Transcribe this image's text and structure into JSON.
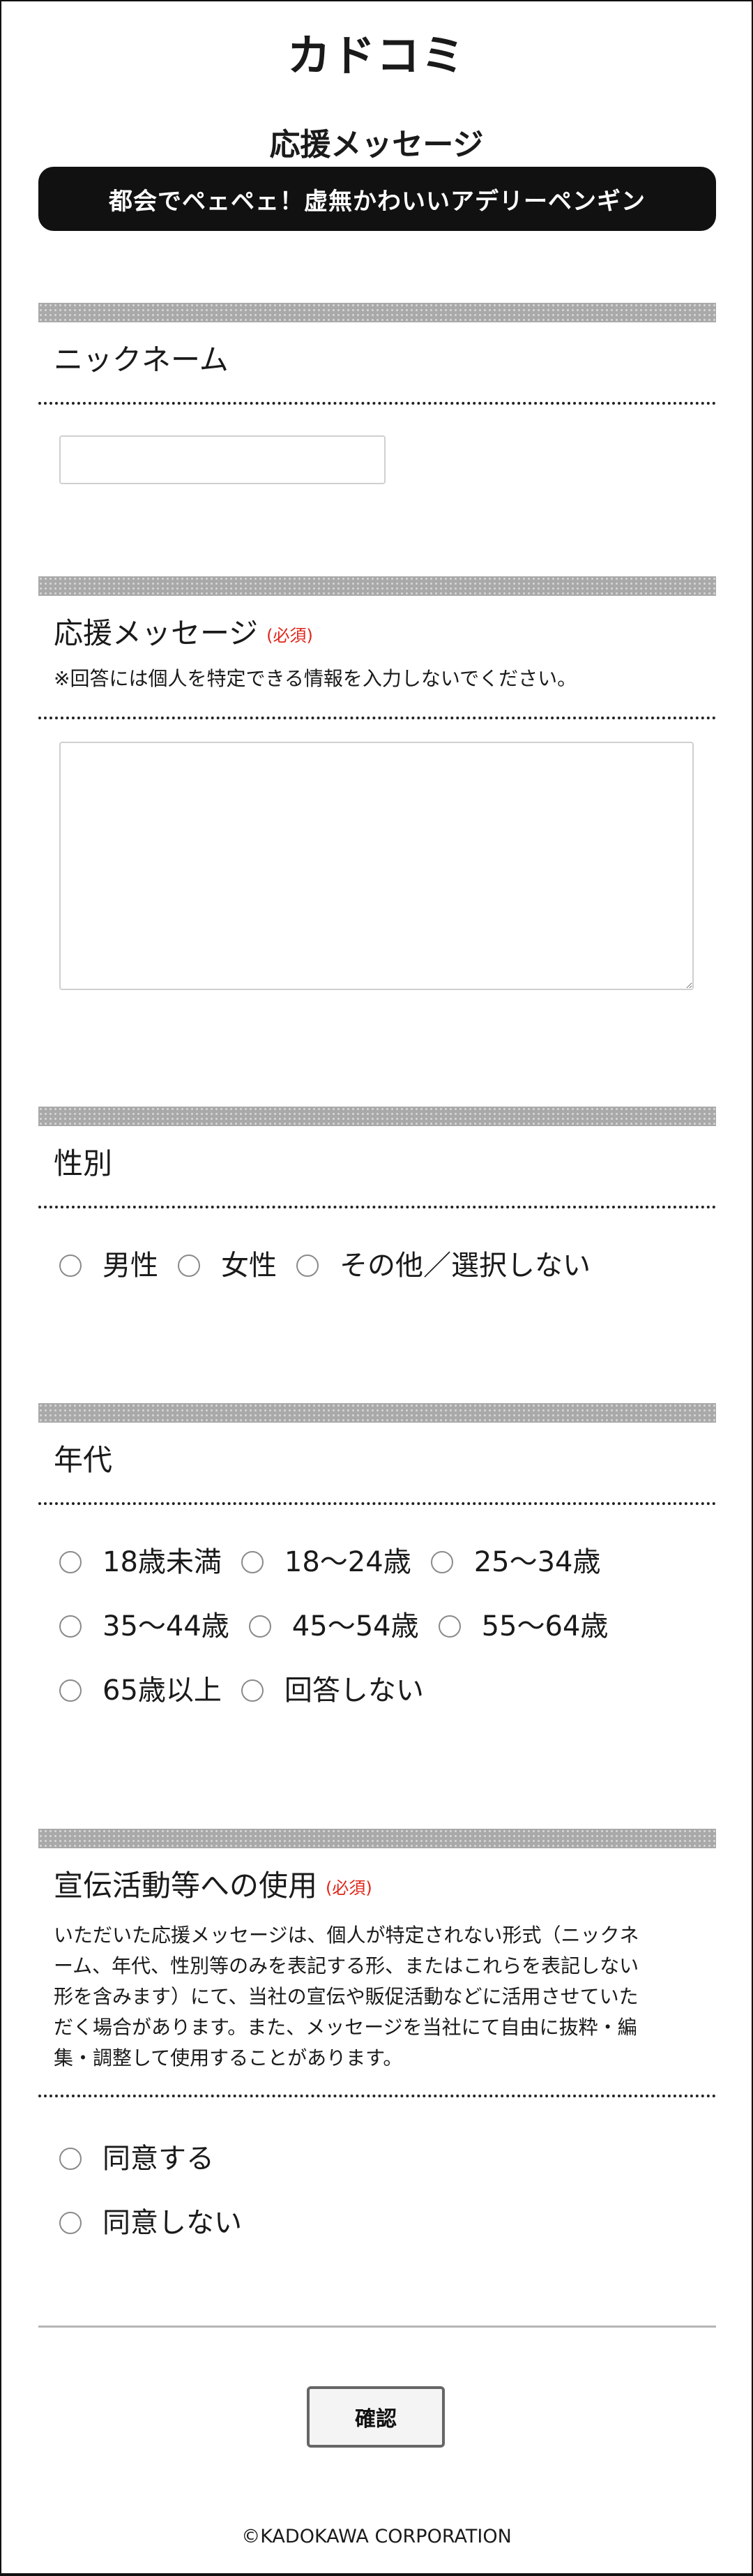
{
  "header": {
    "logo_text": "カドコミ",
    "page_title": "応援メッセージ",
    "banner_title": "都会でペェペェ！虚無かわいいアデリーペンギン"
  },
  "nickname": {
    "label": "ニックネーム",
    "value": "",
    "placeholder": ""
  },
  "message": {
    "label": "応援メッセージ",
    "required": "(必須)",
    "note": "※回答には個人を特定できる情報を入力しないでください。",
    "value": ""
  },
  "gender": {
    "label": "性別",
    "options": [
      "男性",
      "女性",
      "その他／選択しない"
    ]
  },
  "age": {
    "label": "年代",
    "options": [
      "18歳未満",
      "18〜24歳",
      "25〜34歳",
      "35〜44歳",
      "45〜54歳",
      "55〜64歳",
      "65歳以上",
      "回答しない"
    ]
  },
  "promo": {
    "label": "宣伝活動等への使用",
    "required": "(必須)",
    "note_lines": [
      "いただいた応援メッセージは、個人が特定されない形式（ニックネ",
      "ーム、年代、性別等のみを表記する形、またはこれらを表記しない",
      "形を含みます）にて、当社の宣伝や販促活動などに活用させていた",
      "だく場合があります。また、メッセージを当社にて自由に抜粋・編",
      "集・調整して使用することがあります。"
    ],
    "options": [
      "同意する",
      "同意しない"
    ]
  },
  "confirm_label": "確認",
  "footer": "©KADOKAWA CORPORATION"
}
